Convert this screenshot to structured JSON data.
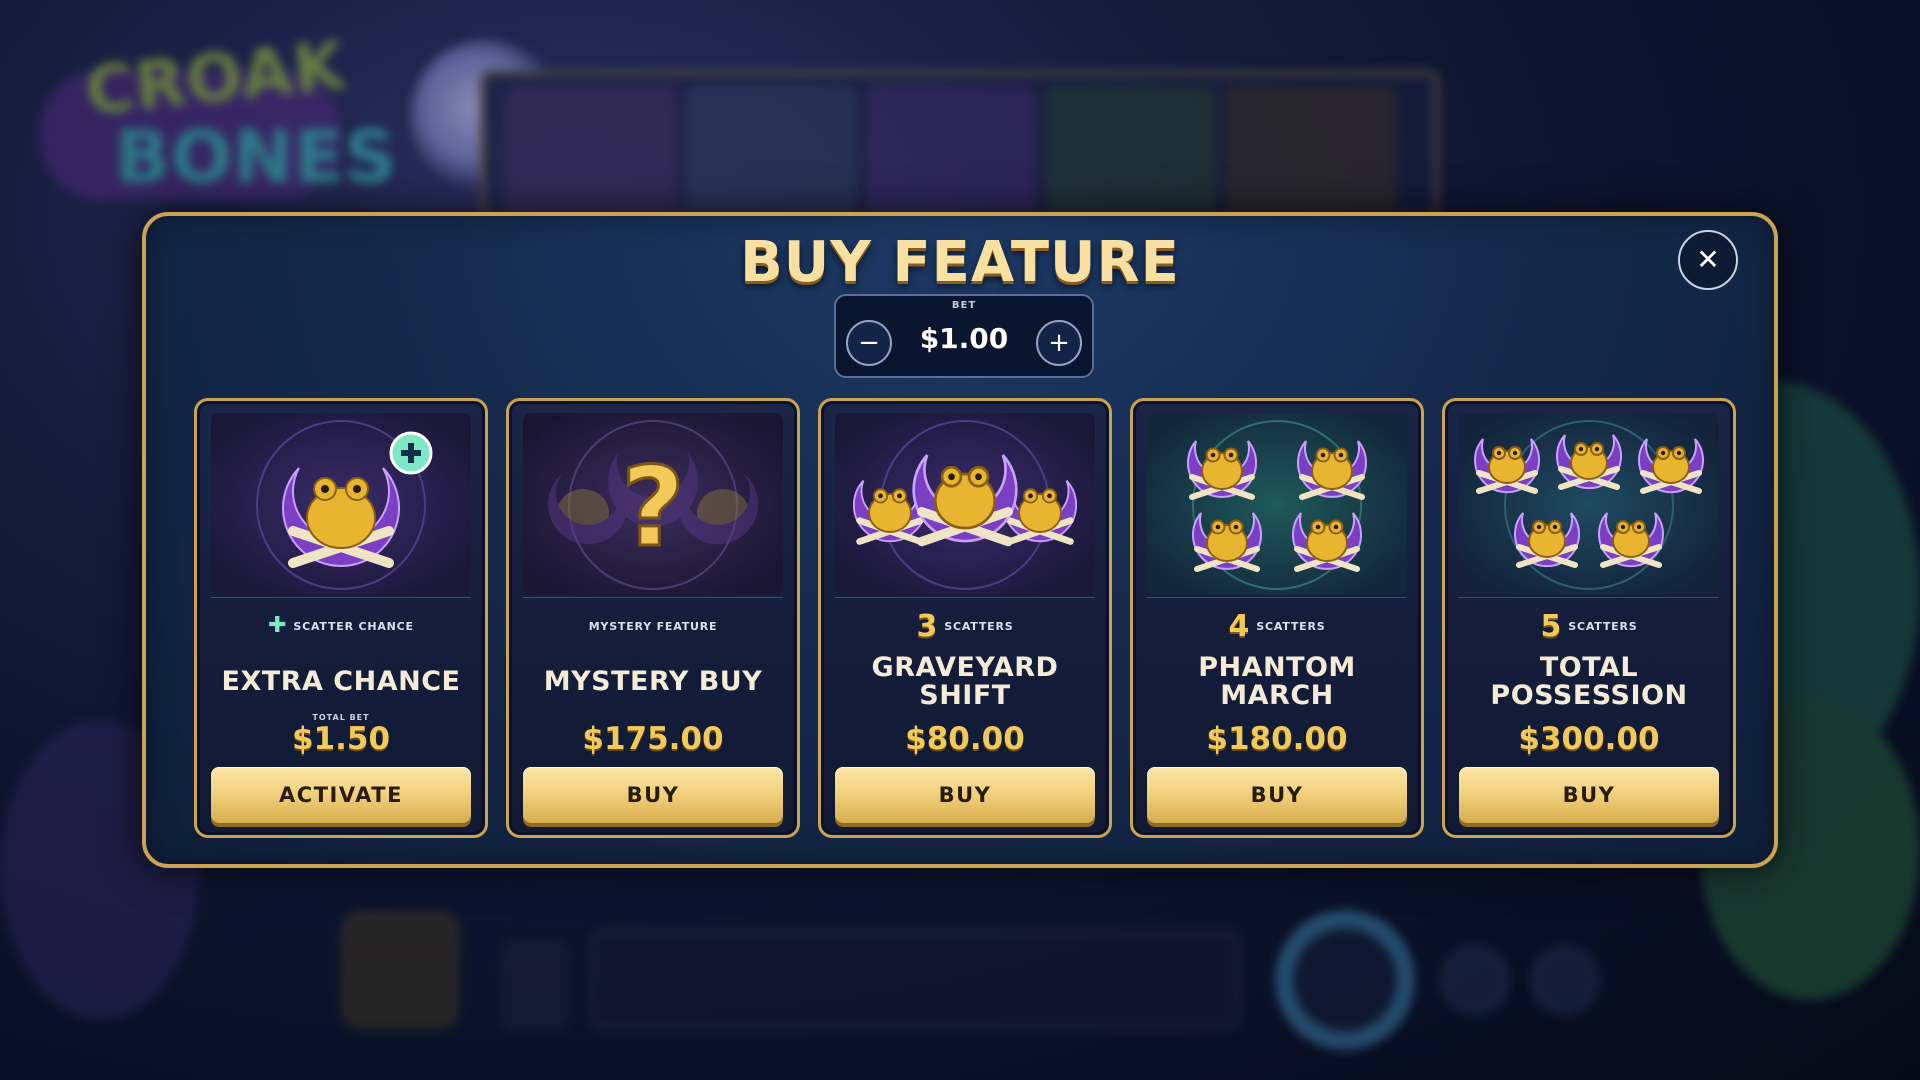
{
  "background": {
    "logo_line1": "CROAK",
    "logo_line2": "BONES"
  },
  "modal": {
    "title": "BUY FEATURE",
    "close_icon": "close-icon",
    "bet": {
      "label": "BET",
      "value": "$1.00",
      "minus_icon": "minus-icon",
      "plus_icon": "plus-icon"
    }
  },
  "cards": [
    {
      "art": "frog-scatter-plus-icon",
      "subtitle_prefix_icon": "plus-icon",
      "subtitle": "SCATTER CHANCE",
      "name": "EXTRA CHANCE",
      "total_label": "TOTAL BET",
      "price": "$1.50",
      "button": "ACTIVATE"
    },
    {
      "art": "mystery-question-icon",
      "subtitle": "MYSTERY FEATURE",
      "name": "MYSTERY BUY",
      "price": "$175.00",
      "button": "BUY"
    },
    {
      "art": "three-frog-scatters-icon",
      "subtitle_count": "3",
      "subtitle": "SCATTERS",
      "name": "GRAVEYARD SHIFT",
      "price": "$80.00",
      "button": "BUY"
    },
    {
      "art": "four-frog-scatters-icon",
      "subtitle_count": "4",
      "subtitle": "SCATTERS",
      "name": "PHANTOM MARCH",
      "price": "$180.00",
      "button": "BUY"
    },
    {
      "art": "five-frog-scatters-icon",
      "subtitle_count": "5",
      "subtitle": "SCATTERS",
      "name": "TOTAL POSSESSION",
      "price": "$300.00",
      "button": "BUY"
    }
  ],
  "colors": {
    "gold": "#c9a352",
    "price": "#f3c95a",
    "button_top": "#fbe7a8",
    "modal_bg": "#152a4c",
    "purple": "#7a3fc2",
    "frog": "#e8b530"
  }
}
